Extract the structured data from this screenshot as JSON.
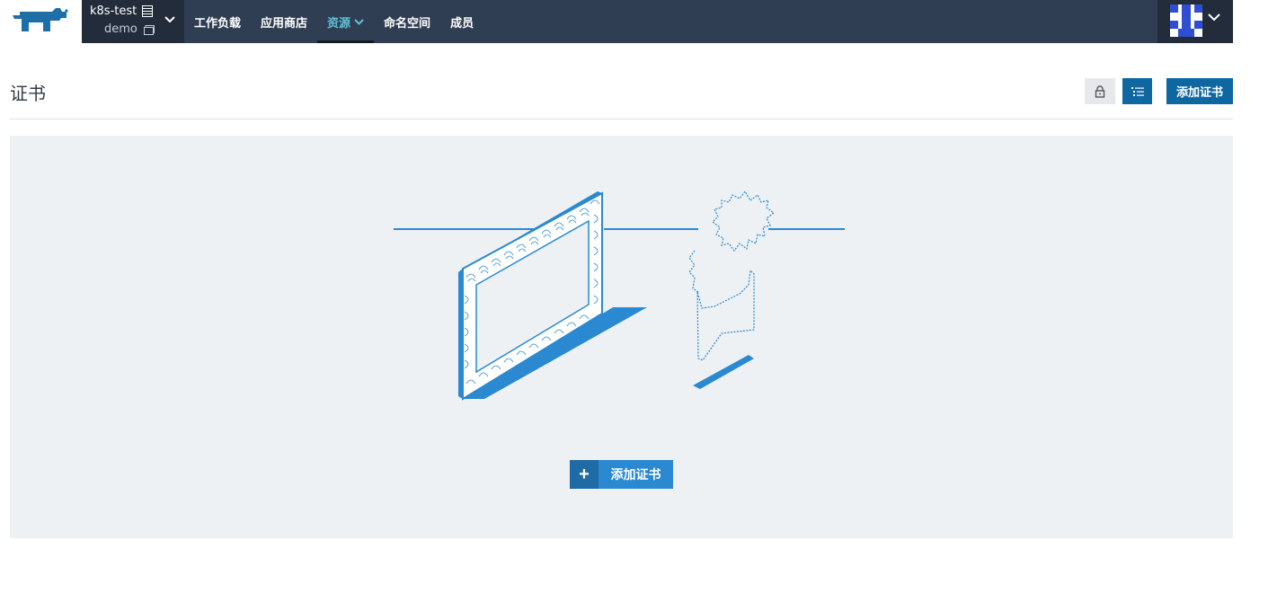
{
  "nav": {
    "cluster": "k8s-test",
    "project": "demo",
    "items": [
      {
        "label": "工作负载"
      },
      {
        "label": "应用商店"
      },
      {
        "label": "资源"
      },
      {
        "label": "命名空间"
      },
      {
        "label": "成员"
      }
    ],
    "active_item": "资源"
  },
  "header": {
    "title": "证书",
    "add_button_label": "添加证书"
  },
  "empty_state": {
    "add_button_label": "添加证书"
  },
  "colors": {
    "nav_bg": "#2f3e52",
    "nav_dark": "#222c3a",
    "accent": "#0f67a1",
    "active_nav": "#5ec3d5",
    "illustration_blue": "#2b89d1",
    "panel_bg": "#edf1f4"
  },
  "icons": [
    "rancher-logo",
    "cluster-icon",
    "project-icon",
    "chevron-down-icon",
    "avatar",
    "ssl-certificate-icon",
    "list-view-icon",
    "plus-icon"
  ]
}
